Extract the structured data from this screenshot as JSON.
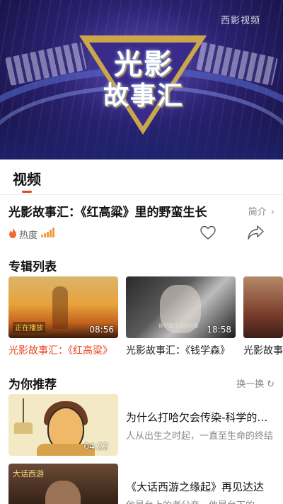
{
  "hero": {
    "watermark": "西影视频",
    "logo_line1": "光影",
    "logo_line2": "故事汇"
  },
  "tabs": {
    "active": "视频"
  },
  "video": {
    "title": "光影故事汇：《红高粱》里的野蛮生长",
    "intro_label": "简介",
    "heat_label": "热度",
    "heat_level_bars": 5
  },
  "album": {
    "section_title": "专辑列表",
    "items": [
      {
        "title": "光影故事汇：《红高粱》",
        "duration": "08:56",
        "badge": "正在播放"
      },
      {
        "title": "光影故事汇：《钱学森》",
        "duration": "18:58",
        "subtitle": "你不能让我回中国"
      },
      {
        "title": "光影故事汇"
      }
    ]
  },
  "recommend": {
    "section_title": "为你推荐",
    "refresh_label": "换一换",
    "items": [
      {
        "title": "为什么打哈欠会传染-科学的解释",
        "desc": "人从出生之时起，一直至生命的终结",
        "duration": "04:22"
      },
      {
        "title": "《大话西游之缘起》再见达达",
        "desc": "他是台上的老父亲，他是台下的",
        "label": "大话西游"
      }
    ]
  },
  "colors": {
    "accent": "#e8471d",
    "heat": "#f19a3e"
  }
}
